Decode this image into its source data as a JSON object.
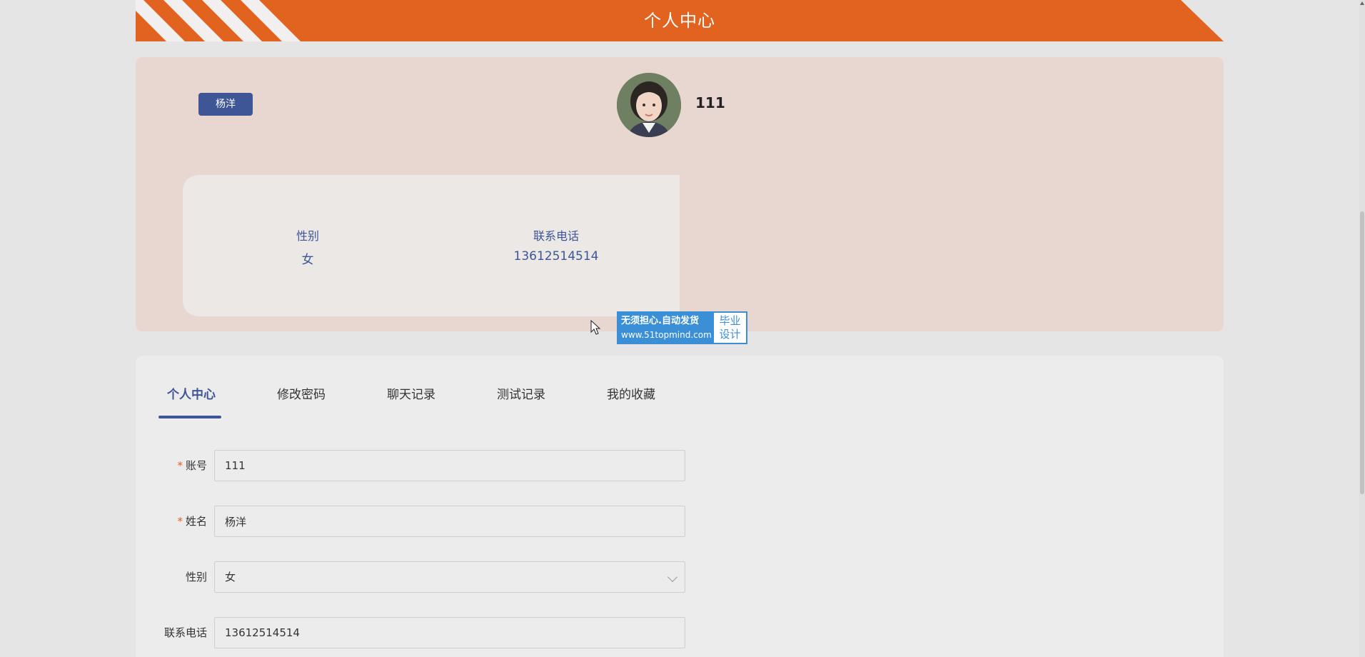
{
  "header": {
    "title": "个人中心"
  },
  "profile": {
    "name_tag": "杨洋",
    "account": "111",
    "info": [
      {
        "label": "性别",
        "value": "女"
      },
      {
        "label": "联系电话",
        "value": "13612514514"
      }
    ]
  },
  "ad": {
    "line1": "无须担心.自动发货",
    "line2": "www.51topmind.com",
    "right1": "毕业",
    "right2": "设计"
  },
  "tabs": [
    {
      "label": "个人中心",
      "active": true
    },
    {
      "label": "修改密码",
      "active": false
    },
    {
      "label": "聊天记录",
      "active": false
    },
    {
      "label": "测试记录",
      "active": false
    },
    {
      "label": "我的收藏",
      "active": false
    }
  ],
  "form": {
    "account": {
      "label": "账号",
      "required_mark": "*",
      "value": "111"
    },
    "name": {
      "label": "姓名",
      "required_mark": "*",
      "value": "杨洋"
    },
    "gender": {
      "label": "性别",
      "value": "女"
    },
    "phone": {
      "label": "联系电话",
      "value": "13612514514"
    }
  },
  "colors": {
    "accent": "#3e5596",
    "brand": "#e2621f",
    "card": "#e8d6d0"
  }
}
